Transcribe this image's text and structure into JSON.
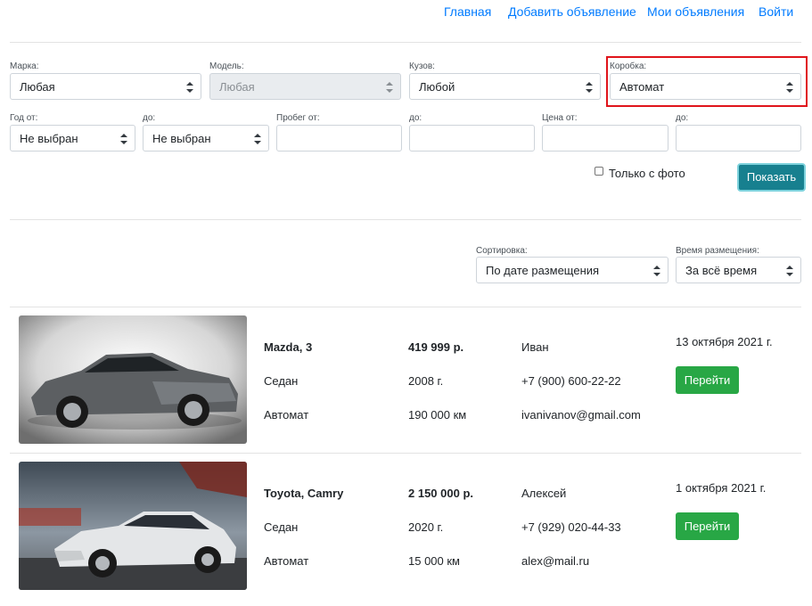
{
  "nav": {
    "home": "Главная",
    "add": "Добавить объявление",
    "mine": "Мои объявления",
    "login": "Войти"
  },
  "filters": {
    "brand": {
      "label": "Марка:",
      "value": "Любая"
    },
    "model": {
      "label": "Модель:",
      "value": "Любая"
    },
    "body": {
      "label": "Кузов:",
      "value": "Любой"
    },
    "gearbox": {
      "label": "Коробка:",
      "value": "Автомат"
    },
    "year_from": {
      "label": "Год от:",
      "value": "Не выбран"
    },
    "year_to": {
      "label": "до:",
      "value": "Не выбран"
    },
    "mileage_from": {
      "label": "Пробег от:",
      "value": ""
    },
    "mileage_to": {
      "label": "до:",
      "value": ""
    },
    "price_from": {
      "label": "Цена от:",
      "value": ""
    },
    "price_to": {
      "label": "до:",
      "value": ""
    },
    "photo_only": {
      "label": "Только с фото",
      "checked": false
    },
    "show_button": "Показать"
  },
  "sorting": {
    "sort": {
      "label": "Сортировка:",
      "value": "По дате размещения"
    },
    "period": {
      "label": "Время размещения:",
      "value": "За всё время"
    }
  },
  "listings": [
    {
      "title": "Mazda, 3",
      "body": "Седан",
      "gearbox": "Автомат",
      "price": "419 999 р.",
      "year": "2008 г.",
      "mileage": "190 000 км",
      "seller": "Иван",
      "phone": "+7 (900) 600-22-22",
      "email": "ivanivanov@gmail.com",
      "date": "13 октября 2021 г.",
      "button": "Перейти"
    },
    {
      "title": "Toyota, Camry",
      "body": "Седан",
      "gearbox": "Автомат",
      "price": "2 150 000 р.",
      "year": "2020 г.",
      "mileage": "15 000 км",
      "seller": "Алексей",
      "phone": "+7 (929) 020-44-33",
      "email": "alex@mail.ru",
      "date": "1 октября 2021 г.",
      "button": "Перейти"
    }
  ]
}
